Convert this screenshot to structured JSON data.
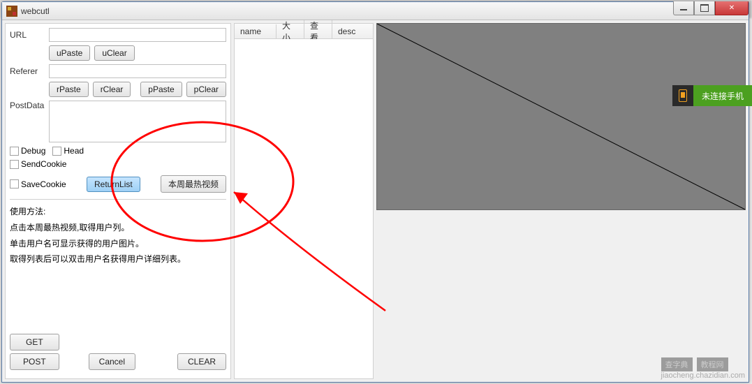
{
  "window": {
    "title": "webcutl"
  },
  "form": {
    "url_label": "URL",
    "referer_label": "Referer",
    "postdata_label": "PostData",
    "buttons": {
      "uPaste": "uPaste",
      "uClear": "uClear",
      "rPaste": "rPaste",
      "rClear": "rClear",
      "pPaste": "pPaste",
      "pClear": "pClear",
      "returnList": "ReturnList",
      "hotVideo": "本周最热视频",
      "get": "GET",
      "post": "POST",
      "cancel": "Cancel",
      "clear": "CLEAR"
    },
    "checks": {
      "debug": "Debug",
      "head": "Head",
      "sendCookie": "SendCookie",
      "saveCookie": "SaveCookie"
    }
  },
  "help": {
    "title": "使用方法:",
    "line1": "点击本周最热视频,取得用户列。",
    "line2": "单击用户名可显示获得的用户图片。",
    "line3": "取得列表后可以双击用户名获得用户详细列表。"
  },
  "list": {
    "columns": {
      "name": "name",
      "size": "大小",
      "view": "查看",
      "desc": "desc"
    }
  },
  "floating": {
    "text": "未连接手机"
  },
  "watermark": {
    "brand": "查字典",
    "site": "教程网",
    "url": "jiaocheng.chazidian.com"
  }
}
